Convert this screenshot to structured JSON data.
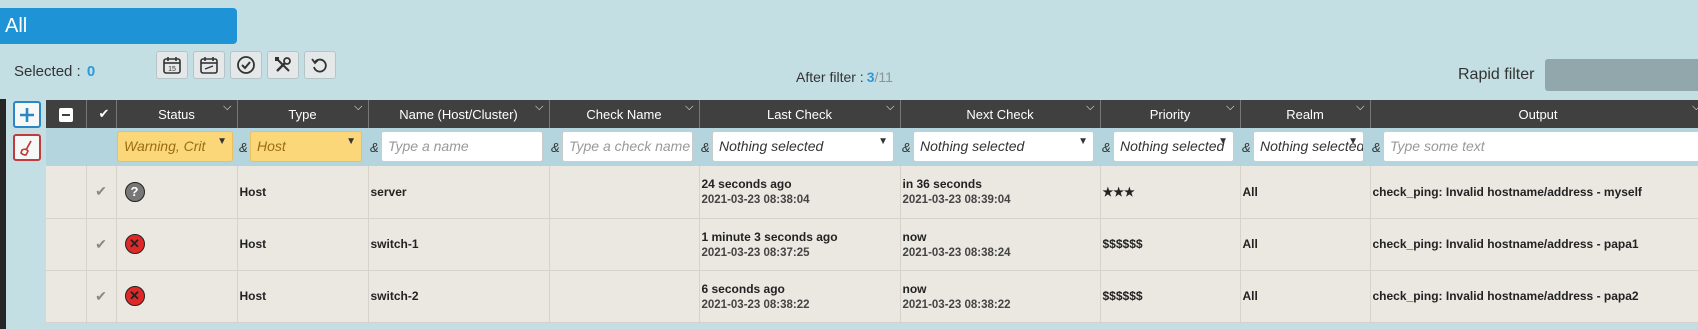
{
  "tab": {
    "label": "All"
  },
  "selection": {
    "label": "Selected :",
    "count": "0"
  },
  "filter_info": {
    "label": "After filter :",
    "shown": "3",
    "total": "/11"
  },
  "rapid_filter": {
    "label": "Rapid filter"
  },
  "toolbar": [
    "calendar-15-icon",
    "calendar-days-icon",
    "check-circle-icon",
    "tools-icon",
    "refresh-icon"
  ],
  "columns": [
    "Status",
    "Type",
    "Name (Host/Cluster)",
    "Check Name",
    "Last Check",
    "Next Check",
    "Priority",
    "Realm",
    "Output"
  ],
  "filters": {
    "status": "Warning, Crit",
    "type": "Host",
    "name_placeholder": "Type a name",
    "check_placeholder": "Type a check name",
    "last_check": "Nothing selected",
    "next_check": "Nothing selected",
    "priority": "Nothing selected",
    "realm": "Nothing selected",
    "output_placeholder": "Type some text",
    "amp": "&"
  },
  "rows": [
    {
      "status": "unknown",
      "status_glyph": "?",
      "type": "Host",
      "name": "server",
      "check": "",
      "last_rel": "24 seconds ago",
      "last_abs": "2021-03-23 08:38:04",
      "next_rel": "in 36 seconds",
      "next_abs": "2021-03-23 08:39:04",
      "priority": "★★★",
      "realm": "All",
      "output": "check_ping: Invalid hostname/address - myself"
    },
    {
      "status": "down",
      "status_glyph": "✕",
      "type": "Host",
      "name": "switch-1",
      "check": "",
      "last_rel": "1 minute 3 seconds ago",
      "last_abs": "2021-03-23 08:37:25",
      "next_rel": "now",
      "next_abs": "2021-03-23 08:38:24",
      "priority": "$$$$$$",
      "realm": "All",
      "output": "check_ping: Invalid hostname/address - papa1"
    },
    {
      "status": "down",
      "status_glyph": "✕",
      "type": "Host",
      "name": "switch-2",
      "check": "",
      "last_rel": "6 seconds ago",
      "last_abs": "2021-03-23 08:38:22",
      "next_rel": "now",
      "next_abs": "2021-03-23 08:38:22",
      "priority": "$$$$$$",
      "realm": "All",
      "output": "check_ping: Invalid hostname/address - papa2"
    }
  ],
  "colors": {
    "accent": "#1e93d6",
    "header_bg": "#404040",
    "filter_active": "#fbd77a",
    "status_down": "#e02828",
    "status_unknown": "#777777"
  }
}
